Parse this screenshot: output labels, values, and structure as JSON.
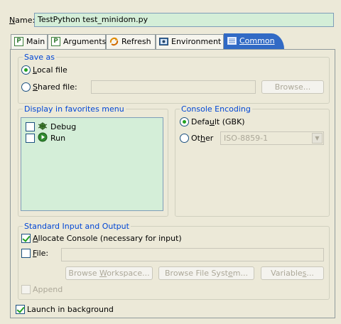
{
  "name": {
    "label_prefix": "N",
    "label_rest": "ame:",
    "value": "TestPython test_minidom.py"
  },
  "tabs": [
    {
      "label": "Main",
      "icon": "python-file-icon"
    },
    {
      "label": "Arguments",
      "icon": "python-file-icon"
    },
    {
      "label": "Refresh",
      "icon": "refresh-icon"
    },
    {
      "label": "Environment",
      "icon": "environment-icon"
    },
    {
      "label": "Common",
      "icon": "common-icon",
      "active": true
    }
  ],
  "save_as": {
    "title": "Save as",
    "local_prefix": "L",
    "local_rest": "ocal file",
    "shared_prefix": "S",
    "shared_rest": "hared file:",
    "browse": "Browse..."
  },
  "favorites": {
    "title": "Display in favorites menu",
    "items": [
      {
        "label": "Debug",
        "icon": "debug-bug-icon",
        "checked": false
      },
      {
        "label": "Run",
        "icon": "run-play-icon",
        "checked": false
      }
    ]
  },
  "encoding": {
    "title": "Console Encoding",
    "default_prefix": "Defa",
    "default_u": "u",
    "default_rest": "lt (GBK)",
    "other_prefix": "Ot",
    "other_u": "h",
    "other_rest": "er",
    "other_value": "ISO-8859-1"
  },
  "std_io": {
    "title": "Standard Input and Output",
    "allocate_u": "A",
    "allocate_rest": "llocate Console (necessary for input)",
    "file_u": "F",
    "file_rest": "ile:",
    "browse_workspace_pre": "Browse ",
    "browse_workspace_u": "W",
    "browse_workspace_post": "orkspace...",
    "browse_fs_pre": "Browse File Syst",
    "browse_fs_u": "e",
    "browse_fs_post": "m...",
    "variables_pre": "Variable",
    "variables_u": "s",
    "variables_post": "...",
    "append": "Append"
  },
  "launch_background": "Launch in background"
}
